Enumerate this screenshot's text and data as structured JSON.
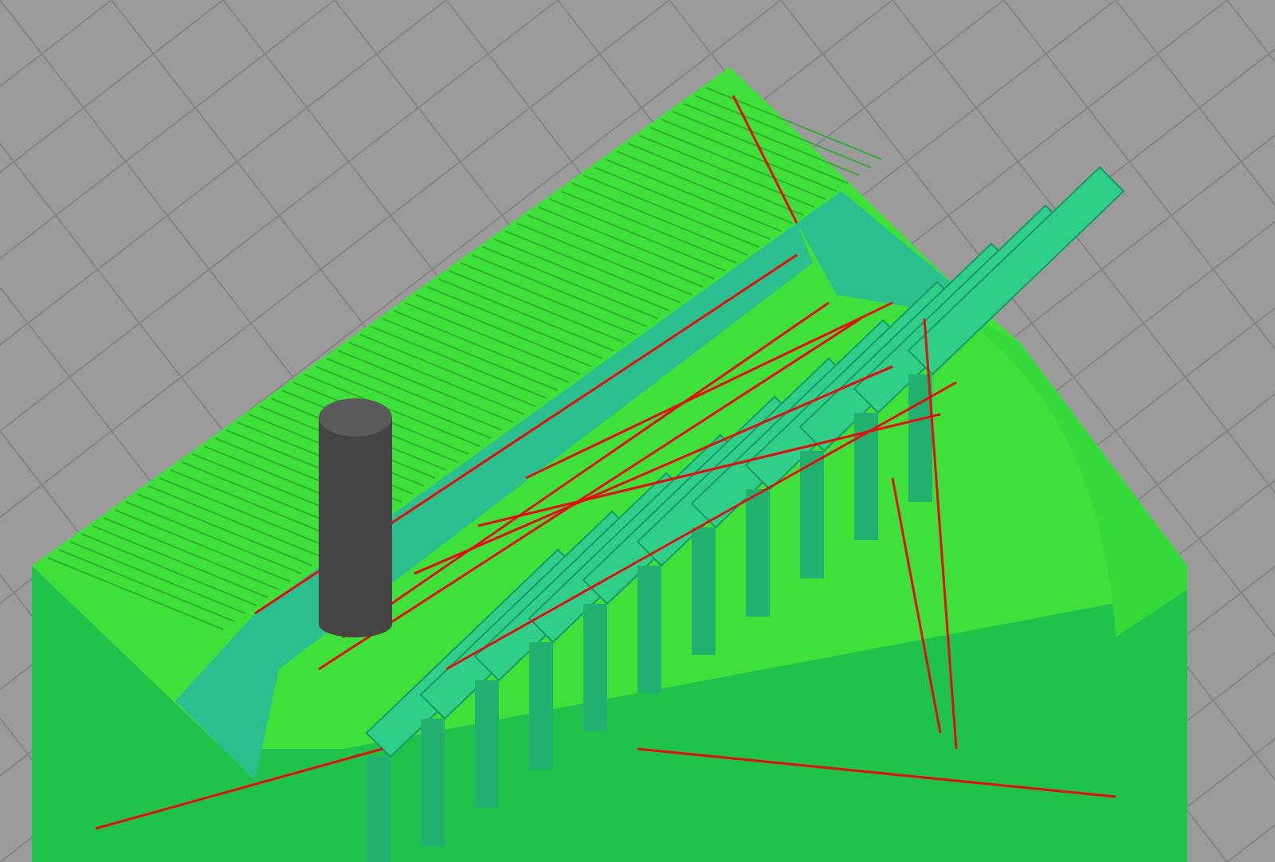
{
  "viewport": {
    "kind": "toolpath-preview"
  }
}
